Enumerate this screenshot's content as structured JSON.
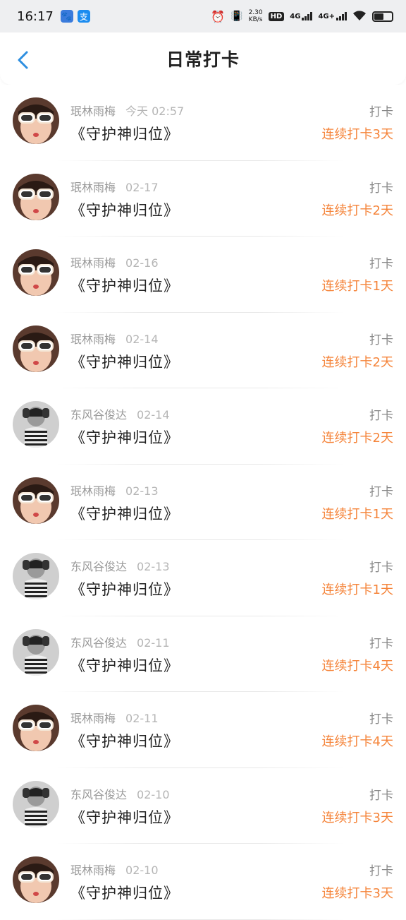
{
  "status": {
    "time": "16:17",
    "speed_value": "2.30",
    "speed_unit": "KB/s",
    "hd_label": "HD",
    "net1": "4G",
    "net2": "4G+"
  },
  "header": {
    "title": "日常打卡"
  },
  "items": [
    {
      "user": "珉林雨梅",
      "date": "今天 02:57",
      "book": "《守护神归位》",
      "type": "打卡",
      "streak": "连续打卡3天",
      "avatar": "sunglasses"
    },
    {
      "user": "珉林雨梅",
      "date": "02-17",
      "book": "《守护神归位》",
      "type": "打卡",
      "streak": "连续打卡2天",
      "avatar": "sunglasses"
    },
    {
      "user": "珉林雨梅",
      "date": "02-16",
      "book": "《守护神归位》",
      "type": "打卡",
      "streak": "连续打卡1天",
      "avatar": "sunglasses"
    },
    {
      "user": "珉林雨梅",
      "date": "02-14",
      "book": "《守护神归位》",
      "type": "打卡",
      "streak": "连续打卡2天",
      "avatar": "sunglasses"
    },
    {
      "user": "东风谷俊达",
      "date": "02-14",
      "book": "《守护神归位》",
      "type": "打卡",
      "streak": "连续打卡2天",
      "avatar": "striped"
    },
    {
      "user": "珉林雨梅",
      "date": "02-13",
      "book": "《守护神归位》",
      "type": "打卡",
      "streak": "连续打卡1天",
      "avatar": "sunglasses"
    },
    {
      "user": "东风谷俊达",
      "date": "02-13",
      "book": "《守护神归位》",
      "type": "打卡",
      "streak": "连续打卡1天",
      "avatar": "striped"
    },
    {
      "user": "东风谷俊达",
      "date": "02-11",
      "book": "《守护神归位》",
      "type": "打卡",
      "streak": "连续打卡4天",
      "avatar": "striped"
    },
    {
      "user": "珉林雨梅",
      "date": "02-11",
      "book": "《守护神归位》",
      "type": "打卡",
      "streak": "连续打卡4天",
      "avatar": "sunglasses"
    },
    {
      "user": "东风谷俊达",
      "date": "02-10",
      "book": "《守护神归位》",
      "type": "打卡",
      "streak": "连续打卡3天",
      "avatar": "striped"
    },
    {
      "user": "珉林雨梅",
      "date": "02-10",
      "book": "《守护神归位》",
      "type": "打卡",
      "streak": "连续打卡3天",
      "avatar": "sunglasses"
    }
  ],
  "colors": {
    "accent": "#2d8ee0",
    "streak": "#f5843a"
  }
}
